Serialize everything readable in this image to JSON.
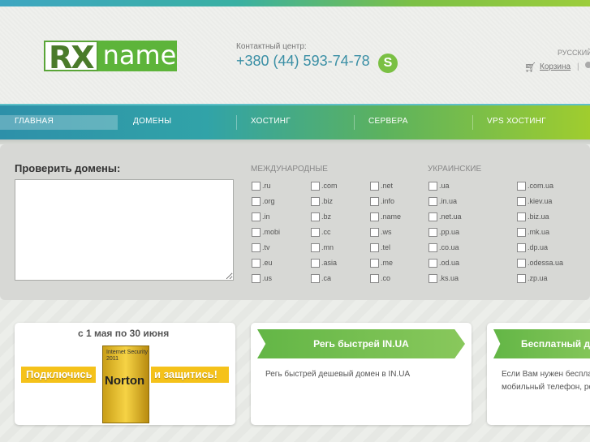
{
  "header": {
    "logo_rx": "RX",
    "logo_name": "name",
    "contact_label": "Контактный центр:",
    "phone": "+380 (44) 593-74-78",
    "skype_icon": "skype-icon",
    "language": "РУССКИЙ",
    "cart_label": "Корзина",
    "separator": "|"
  },
  "nav": {
    "items": [
      "ГЛАВНАЯ",
      "ДОМЕНЫ",
      "ХОСТИНГ",
      "СЕРВЕРА",
      "VPS ХОСТИНГ"
    ],
    "active_index": 0
  },
  "domain_check": {
    "title": "Проверить домены:",
    "textarea_value": "",
    "international_title": "МЕЖДУНАРОДНЫЕ",
    "ukrainian_title": "УКРАИНСКИЕ",
    "international_col1": [
      ".ru",
      ".org",
      ".in",
      ".mobi",
      ".tv",
      ".eu",
      ".us"
    ],
    "international_col2": [
      ".com",
      ".biz",
      ".bz",
      ".cc",
      ".mn",
      ".asia",
      ".ca"
    ],
    "international_col3": [
      ".net",
      ".info",
      ".name",
      ".ws",
      ".tel",
      ".me",
      ".co"
    ],
    "ukrainian_col1": [
      ".ua",
      ".in.ua",
      ".net.ua",
      ".pp.ua",
      ".co.ua",
      ".od.ua",
      ".ks.ua"
    ],
    "ukrainian_col2": [
      ".com.ua",
      ".kiev.ua",
      ".biz.ua",
      ".mk.ua",
      ".dp.ua",
      ".odessa.ua",
      ".zp.ua"
    ]
  },
  "cards": {
    "promo_date": "с 1 мая по 30 июня",
    "promo_left": "Подключись",
    "promo_right": "и защитись!",
    "promo_box_top": "Internet Security 2011",
    "promo_box_brand": "Norton",
    "card2_title": "Регь быстрей IN.UA",
    "card2_text": "Регь быстрей дешевый домен в IN.UA",
    "card3_title": "Бесплатный д",
    "card3_text_line1": "Если Вам нужен беспла",
    "card3_text_line2": "мобильный телефон, ре"
  },
  "colors": {
    "accent_teal": "#2d90a9",
    "accent_green": "#63b646",
    "phone_color": "#3a8fa5"
  }
}
